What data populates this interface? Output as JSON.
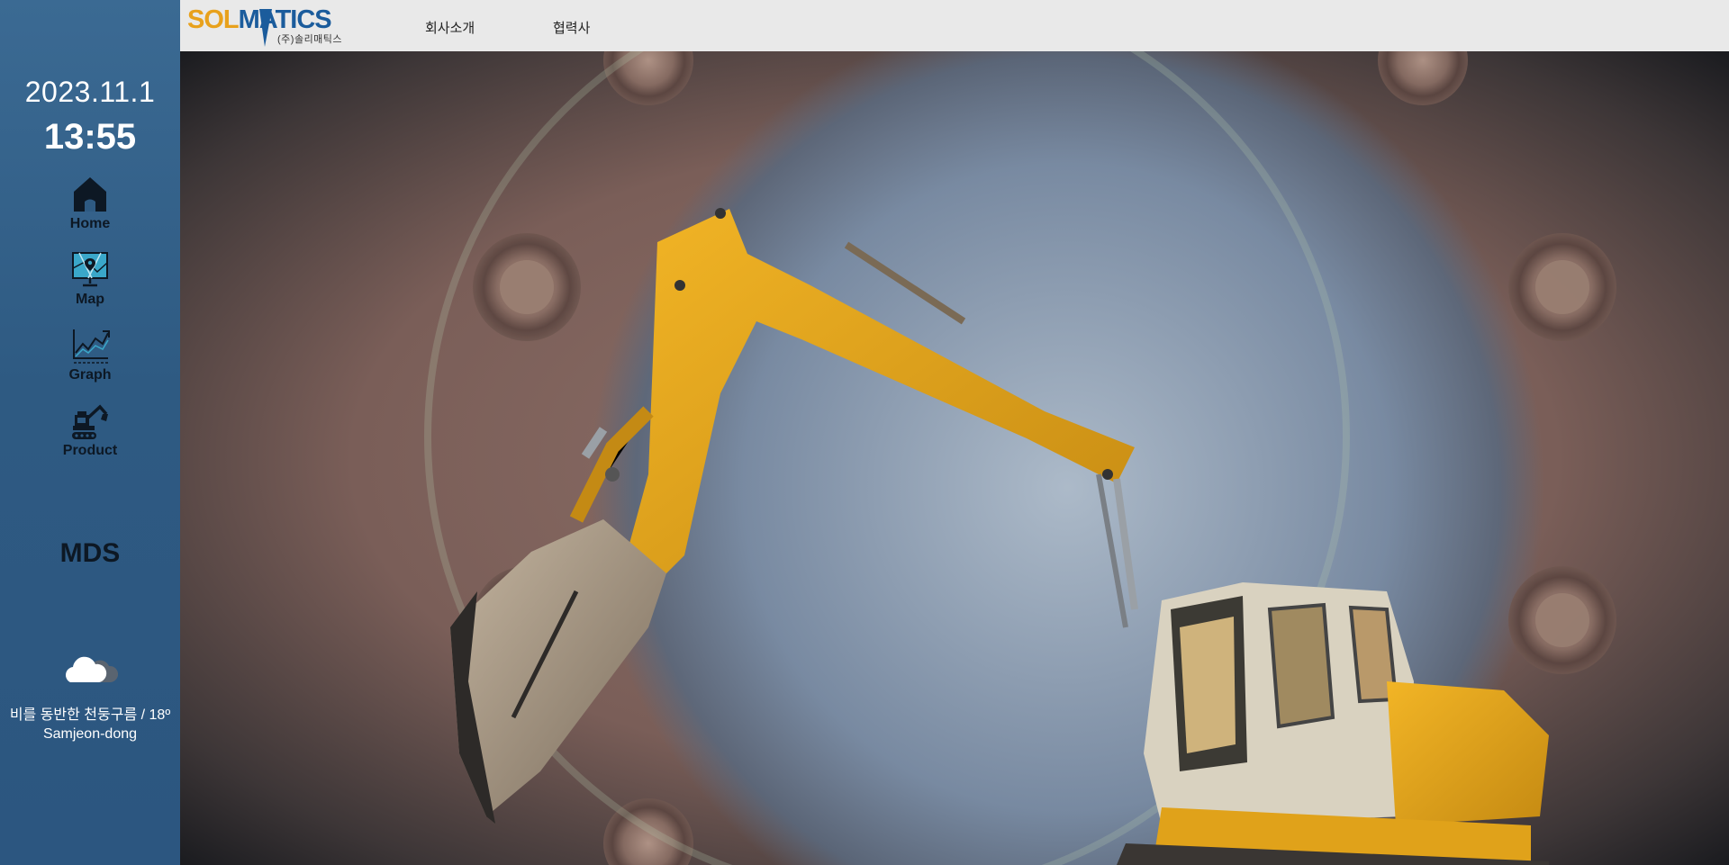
{
  "sidebar": {
    "date": "2023.11.1",
    "time": "13:55",
    "nav": [
      {
        "label": "Home",
        "icon": "home-icon"
      },
      {
        "label": "Map",
        "icon": "map-icon"
      },
      {
        "label": "Graph",
        "icon": "graph-icon"
      },
      {
        "label": "Product",
        "icon": "excavator-icon"
      }
    ],
    "section_title": "MDS",
    "weather": {
      "icon": "cloud-icon",
      "description": "비를 동반한 천둥구름 / 18º",
      "location": "Samjeon-dong"
    }
  },
  "header": {
    "logo_part1": "SOL",
    "logo_part2": "MATICS",
    "logo_sub": "(주)솔리매틱스",
    "menu": [
      "회사소개",
      "협력사"
    ]
  },
  "colors": {
    "sidebar_bg": "#2e5a82",
    "topbar_bg": "#e9e9e9",
    "logo_orange": "#e8a11c",
    "logo_blue": "#1b5c9c",
    "excavator_yellow": "#e0a21a"
  }
}
